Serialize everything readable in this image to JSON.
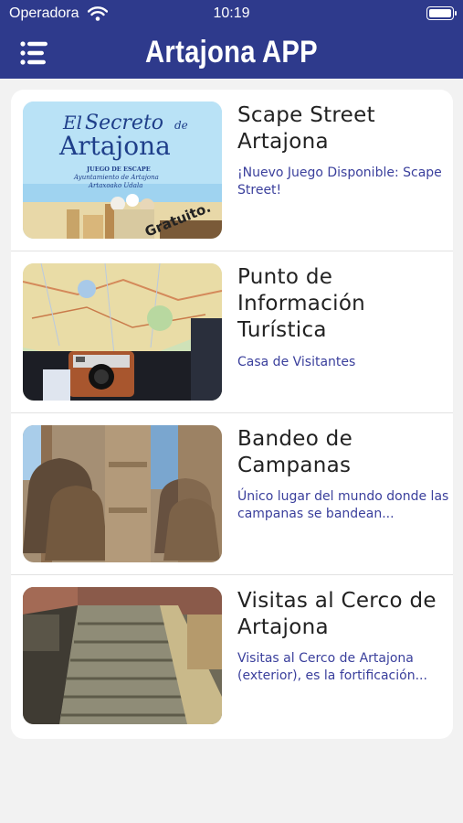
{
  "status_bar": {
    "carrier": "Operadora",
    "time": "10:19"
  },
  "header": {
    "title": "Artajona APP"
  },
  "items": [
    {
      "title": "Scape Street Artajona",
      "subtitle": "¡Nuevo Juego Disponible: Scape Street!",
      "thumb_text": {
        "line1": "El",
        "line2": "Secreto",
        "line3": "de",
        "line4": "Artajona",
        "line5": "JUEGO DE ESCAPE",
        "line6": "Ayuntamiento de Artajona",
        "line7": "Artaxoako Udala",
        "badge": "Gratuito."
      }
    },
    {
      "title": "Punto de Información Turística",
      "subtitle": "Casa de Visitantes"
    },
    {
      "title": " Bandeo de Campanas",
      "subtitle": "Único lugar del mundo donde las campanas se bandean..."
    },
    {
      "title": "Visitas al Cerco de Artajona",
      "subtitle": "Visitas al Cerco de Artajona (exterior), es la fortificación..."
    }
  ],
  "colors": {
    "header": "#2e3a8c",
    "subtitle": "#3a3f9c",
    "background": "#f2f2f2"
  },
  "icons": {
    "menu": "menu-icon",
    "wifi": "wifi-icon",
    "battery": "battery-icon"
  }
}
